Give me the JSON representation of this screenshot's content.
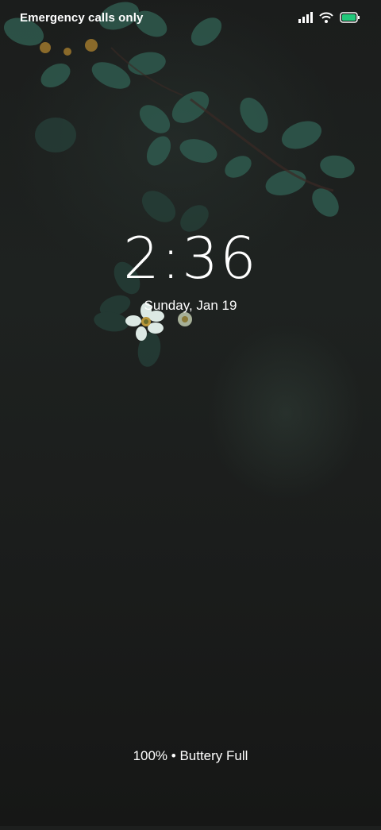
{
  "status_bar": {
    "carrier_text": "Emergency calls only",
    "icons": [
      "signal-icon",
      "wifi-icon",
      "battery-icon"
    ],
    "battery_color": "#22c77a"
  },
  "lockscreen": {
    "time": "2:36",
    "date": "Sunday, Jan 19",
    "battery_status": "100% • Buttery Full"
  },
  "wallpaper": {
    "subject": "flowers-and-leaves",
    "leaf_color": "#3c6a5c",
    "background_color": "#1d1f1e"
  }
}
